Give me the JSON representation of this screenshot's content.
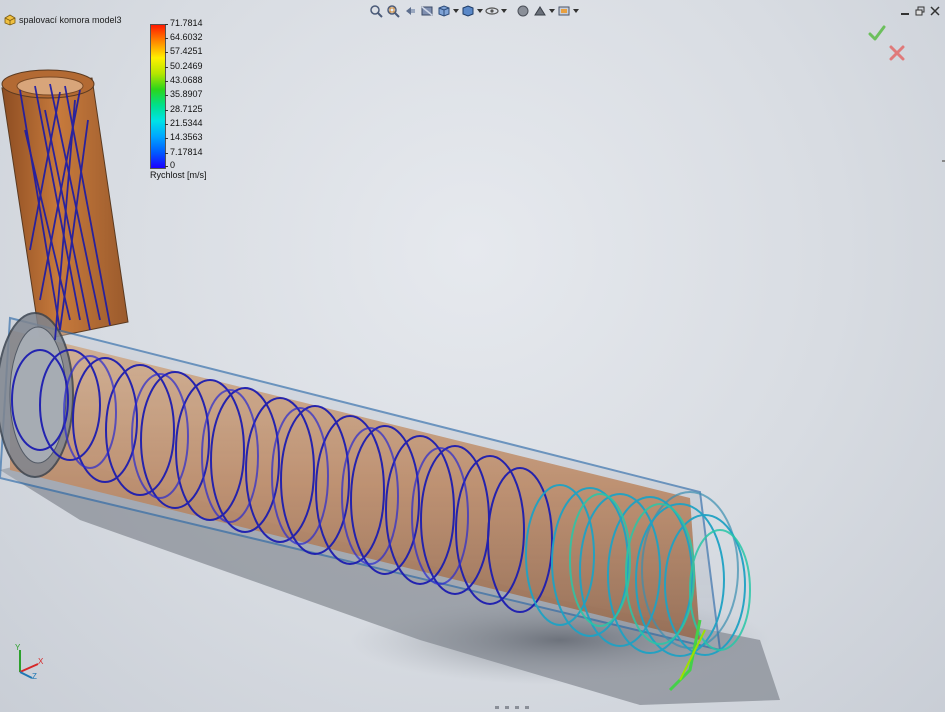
{
  "document": {
    "title": "spalovací komora model3",
    "icon": "part-icon"
  },
  "toolbar": {
    "buttons": [
      {
        "name": "zoom-to-fit-icon"
      },
      {
        "name": "zoom-to-area-icon"
      },
      {
        "name": "previous-view-icon"
      },
      {
        "name": "section-view-icon"
      },
      {
        "name": "view-orientation-icon"
      },
      {
        "name": "display-style-icon"
      },
      {
        "name": "hide-show-items-icon"
      },
      {
        "name": "edit-appearance-icon"
      },
      {
        "name": "apply-scene-icon"
      },
      {
        "name": "view-settings-icon"
      }
    ]
  },
  "legend": {
    "title": "Rychlost [m/s]",
    "ticks": [
      "71.7814",
      "64.6032",
      "57.4251",
      "50.2469",
      "43.0688",
      "35.8907",
      "28.7125",
      "21.5344",
      "14.3563",
      "7.17814",
      "0"
    ],
    "min": 0,
    "max": 71.7814,
    "colors": [
      "#1b00ff",
      "#005cff",
      "#00a6ff",
      "#00e2e6",
      "#00e08a",
      "#2cd51a",
      "#b5e600",
      "#fff000",
      "#ff8c00",
      "#ff1a00"
    ]
  },
  "confirm_corner": {
    "ok_icon": "green-check-icon",
    "cancel_icon": "red-x-icon",
    "ok_color": "#5cb85c",
    "cancel_color": "#d9534f"
  },
  "triad": {
    "x_label": "X",
    "y_label": "Y",
    "z_label": "Z"
  },
  "colors": {
    "pipe_body": "#c77a3c",
    "pipe_shadow": "#8a8f98",
    "streamline_low": "#1a1aa8",
    "streamline_mid": "#1fa2c4"
  }
}
